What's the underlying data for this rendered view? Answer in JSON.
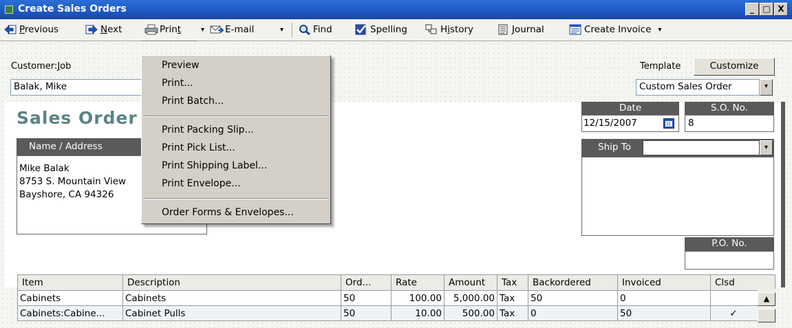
{
  "window": {
    "title": "Create Sales Orders",
    "minimize": "_",
    "restore": "□",
    "close": "X"
  },
  "toolbar": {
    "previous": {
      "pre": "",
      "u": "P",
      "post": "revious"
    },
    "next": {
      "pre": "",
      "u": "N",
      "post": "ext"
    },
    "print": {
      "pre": "Prin",
      "u": "t",
      "post": ""
    },
    "email": "E-mail",
    "find": "Find",
    "spelling": {
      "pre": "Spellin",
      "u": "g",
      "post": ""
    },
    "history": {
      "pre": "H",
      "u": "i",
      "post": "story"
    },
    "journal": "Journal",
    "create_invoice": "Create Invoice",
    "dropdown_arrow": "▾"
  },
  "print_menu": {
    "items": [
      "Preview",
      "Print...",
      "Print Batch...",
      "Print Packing Slip...",
      "Print Pick List...",
      "Print Shipping Label...",
      "Print Envelope...",
      "Order Forms & Envelopes..."
    ]
  },
  "header": {
    "customer_job_label": {
      "pre": "Customer:",
      "u": "J",
      "post": "ob"
    },
    "customer_job_value": "Balak, Mike",
    "template_label": "Template",
    "customize_button": "Customize",
    "template_value": "Custom Sales Order"
  },
  "document": {
    "title": "Sales Order",
    "name_address_label": "Name / Address",
    "address_lines": [
      "Mike Balak",
      "8753 S. Mountain View",
      "Bayshore, CA  94326"
    ],
    "date_label": "Date",
    "date_value": "12/15/2007",
    "so_no_label": "S.O. No.",
    "so_no_value": "8",
    "ship_to_label": "Ship To",
    "ship_to_value": "",
    "po_no_label": "P.O. No.",
    "po_no_value": ""
  },
  "table": {
    "columns": [
      "Item",
      "Description",
      "Ord...",
      "Rate",
      "Amount",
      "Tax",
      "Backordered",
      "Invoiced",
      "Clsd"
    ],
    "rows": [
      [
        "Cabinets",
        "Cabinets",
        "50",
        "100.00",
        "5,000.00",
        "Tax",
        "50",
        "0",
        ""
      ],
      [
        "Cabinets:Cabine...",
        "Cabinet Pulls",
        "50",
        "10.00",
        "500.00",
        "Tax",
        "0",
        "50",
        "✓"
      ]
    ]
  },
  "colors": {
    "titlebar": "#1f58c2",
    "doc_title": "#5b8485",
    "header_box": "#5a5a5a"
  }
}
